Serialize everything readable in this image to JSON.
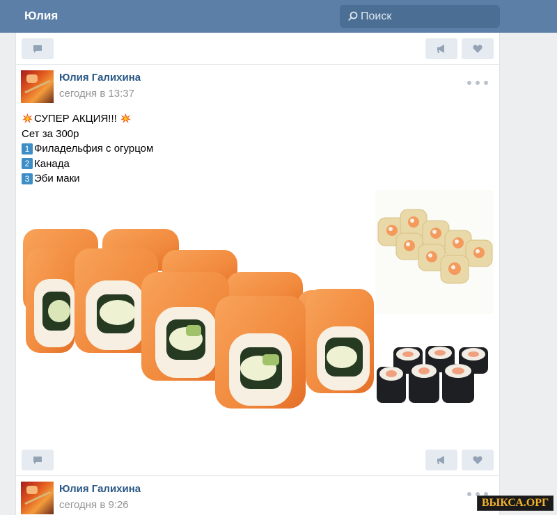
{
  "topbar": {
    "title": "Юлия",
    "search_placeholder": "Поиск"
  },
  "posts": [
    {
      "author": "Юлия Галихина",
      "time": "сегодня в 13:37",
      "lines": [
        "СУПЕР АКЦИЯ!!!",
        "Сет за 300р",
        "Филадельфия с огурцом",
        "Канада",
        "Эби маки"
      ],
      "list_numbers": [
        "1",
        "2",
        "3"
      ]
    },
    {
      "author": "Юлия Галихина",
      "time": "сегодня в 9:26"
    }
  ],
  "icons": {
    "comment": "comment-icon",
    "share": "megaphone-icon",
    "like": "heart-icon",
    "more": "more-dots-icon",
    "search": "search-icon",
    "burst": "collision-emoji-icon"
  },
  "watermark": "ВЫКСА.ОРГ",
  "colors": {
    "topbar": "#5b7fa6",
    "link": "#2a5885",
    "button_bg": "#e5ebf1",
    "icon": "#93a3b5"
  }
}
